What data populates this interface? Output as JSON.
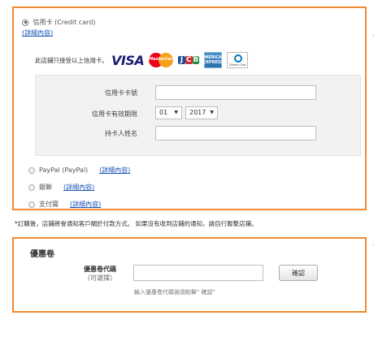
{
  "payment": {
    "credit_card": {
      "label": "信用卡 (Credit card)",
      "details_link": "(詳細內容)",
      "selected": true,
      "accepted_text": "此店鋪只接受以上信用卡。",
      "logos": {
        "visa": "VISA",
        "mastercard": "MasterCard",
        "jcb": [
          "J",
          "C",
          "B"
        ],
        "amex": "AMERICAN EXPRESS",
        "diners": "Diners Club"
      },
      "form": {
        "card_number_label": "信用卡卡號",
        "card_number_value": "",
        "expiry_label": "信用卡有效期限",
        "expiry_month": "01",
        "expiry_year": "2017",
        "holder_label": "持卡人姓名",
        "holder_value": ""
      }
    },
    "options": [
      {
        "label": "PayPal (PayPal)",
        "details_link": "(詳細內容)"
      },
      {
        "label": "銀聯",
        "details_link": "(詳細內容)"
      },
      {
        "label": "支付寶",
        "details_link": "(詳細內容)"
      }
    ],
    "side_mark": "·"
  },
  "notice": "*訂購後，店鋪將會通知客戶關於付款方式。 如果沒有收到店鋪的通知，請自行聯繫店鋪。",
  "coupon": {
    "title": "優惠卷",
    "code_label": "優惠卷代碼",
    "optional": "（可選擇）",
    "code_value": "",
    "confirm_label": "確認",
    "hint": "輸入優惠卷代碼後請點擊\" 確認\"",
    "side_mark": "·"
  },
  "colors": {
    "panel_border": "#f08a33",
    "link": "#1a55b5",
    "form_bg": "#f2f2f2"
  }
}
